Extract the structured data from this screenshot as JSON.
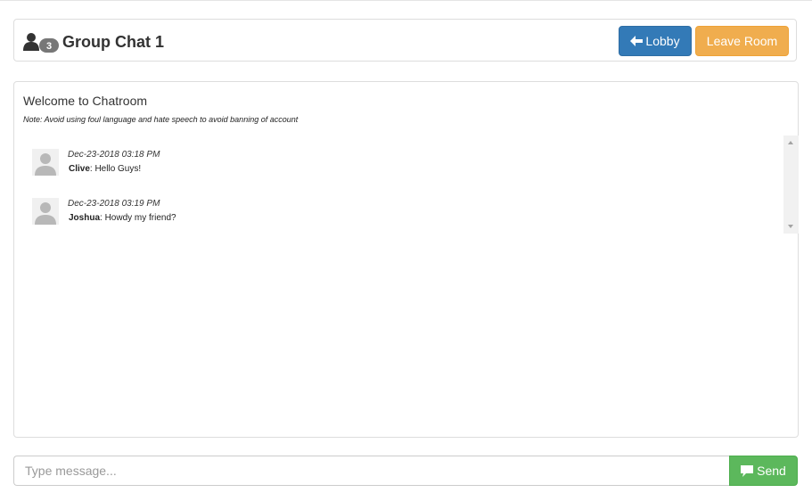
{
  "header": {
    "participant_count": "3",
    "room_name": "Group Chat 1",
    "lobby_label": "Lobby",
    "leave_label": "Leave Room",
    "user_icon": "user-icon",
    "lobby_icon": "arrow-left-icon"
  },
  "chat": {
    "welcome": "Welcome to Chatroom",
    "note": "Note: Avoid using foul language and hate speech to avoid banning of account",
    "messages": [
      {
        "time": "Dec-23-2018 03:18 PM",
        "user": "Clive",
        "text": ": Hello Guys!"
      },
      {
        "time": "Dec-23-2018 03:19 PM",
        "user": "Joshua",
        "text": ": Howdy my friend?"
      }
    ]
  },
  "composer": {
    "placeholder": "Type message...",
    "value": "",
    "send_label": "Send",
    "send_icon": "comment-icon"
  },
  "colors": {
    "primary": "#337ab7",
    "warning": "#f0ad4e",
    "success": "#5cb85c",
    "badge": "#777777"
  }
}
